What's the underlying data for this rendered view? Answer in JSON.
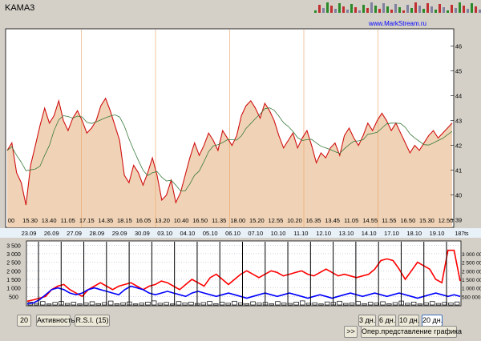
{
  "window": {
    "title": "KAMA3",
    "credit": "www.MarkStream.ru"
  },
  "toolbar": {
    "period_value": "20",
    "activity_label": "Активность",
    "rsi_label": "R.S.I. (15)",
    "scroll_label": ">>",
    "ranges": [
      {
        "label": "3 дн.",
        "active": false
      },
      {
        "label": "6 дн.",
        "active": false
      },
      {
        "label": "10 дн.",
        "active": false
      },
      {
        "label": "20 дн.",
        "active": true
      }
    ],
    "chart_mode_label": "Опер.представление графика"
  },
  "colors": {
    "plot_bg": "#ffffff",
    "price_fill": "#f0d3b6",
    "price_line": "#d01010",
    "sma_line": "#3a7a3a",
    "vertical_markers": "#e8a060",
    "volume_up": "#ff0000",
    "volume_down": "#0000ff",
    "activity_bars": "#000000",
    "day_separator": "#000000",
    "strip_bg": "#e8f0f8"
  },
  "chart_data": [
    {
      "type": "line",
      "series": [
        {
          "values": [
            41.8,
            42.1,
            40.9,
            40.5,
            39.6,
            41.2,
            42.0,
            42.8,
            43.5,
            42.9,
            43.2,
            43.8,
            43.0,
            42.6,
            43.1,
            43.4,
            43.0,
            42.5,
            42.7,
            43.0,
            43.6,
            43.9,
            43.4,
            42.8,
            42.2,
            40.8,
            40.5,
            41.2,
            40.9,
            40.4,
            40.9,
            41.5,
            40.8,
            39.8,
            40.0,
            40.6,
            39.7,
            40.1,
            40.8,
            41.5,
            42.1,
            41.6,
            42.0,
            42.5,
            42.2,
            41.8,
            42.6,
            42.3,
            42.0,
            42.4,
            43.2,
            43.6,
            43.8,
            43.5,
            43.1,
            43.7,
            43.4,
            43.0,
            42.4,
            41.9,
            42.2,
            42.5,
            41.9,
            42.3,
            42.6,
            42.0,
            41.3,
            41.7,
            41.5,
            41.9,
            42.1,
            41.6,
            42.4,
            42.7,
            42.3,
            42.0,
            42.4,
            42.9,
            42.6,
            43.0,
            43.3,
            43.0,
            42.6,
            42.9,
            42.5,
            42.1,
            41.7,
            42.0,
            41.8,
            42.1,
            42.4,
            42.6,
            42.3,
            42.5,
            42.7,
            42.9
          ]
        },
        {
          "values": []
        }
      ],
      "x_tick_labels": [
        "00",
        "15.30",
        "13.40",
        "11.05",
        "17.15",
        "14.35",
        "18.15",
        "16.05",
        "13.20",
        "10.40",
        "16.50",
        "11.35",
        "18.00",
        "15.20",
        "12.55",
        "10.20",
        "16.35",
        "13.45",
        "11.05",
        "14.55",
        "11.55",
        "16.50",
        "15.30",
        "12.50"
      ],
      "y_tick_labels": [
        "39",
        "40",
        "41",
        "42",
        "43",
        "44",
        "45",
        "46"
      ],
      "ylim": [
        38.7,
        46.7
      ]
    },
    {
      "type": "line",
      "series": [
        {
          "values": [
            220,
            300,
            400,
            500,
            900,
            1100,
            1200,
            900,
            700,
            500,
            900,
            1100,
            1300,
            1100,
            900,
            1100,
            1200,
            1300,
            1100,
            900,
            1100,
            1200,
            1400,
            1300,
            1100,
            900,
            1200,
            1500,
            1300,
            1100,
            1600,
            1800,
            1500,
            1200,
            1500,
            1800,
            2000,
            1800,
            1600,
            1800,
            2000,
            1900,
            1700,
            1800,
            1900,
            2000,
            1800,
            1700,
            1900,
            2100,
            1900,
            1700,
            1800,
            1700,
            1600,
            1700,
            1800,
            2100,
            2600,
            2700,
            2600,
            2100,
            1500,
            2000,
            2500,
            2300,
            2100,
            1500,
            1300,
            3200,
            3200,
            1400
          ]
        },
        {
          "values": [
            60,
            120,
            300,
            600,
            900,
            1000,
            900,
            700,
            600,
            700,
            900,
            1000,
            900,
            800,
            700,
            600,
            900,
            1100,
            1000,
            900,
            700,
            600,
            700,
            800,
            700,
            600,
            500,
            700,
            800,
            700,
            600,
            500,
            600,
            700,
            600,
            500,
            400,
            500,
            600,
            700,
            600,
            500,
            600,
            700,
            600,
            500,
            400,
            500,
            600,
            500,
            400,
            500,
            600,
            700,
            600,
            500,
            600,
            700,
            600,
            500,
            600,
            700,
            600,
            500,
            400,
            500,
            600,
            700,
            600,
            500,
            600,
            500
          ]
        }
      ],
      "x_tick_labels": [
        "23.09",
        "26.09",
        "27.09",
        "28.09",
        "29.09",
        "30.09",
        "03.10",
        "04.10",
        "05.10",
        "06.10",
        "07.10",
        "10.10",
        "11.10",
        "12.10",
        "13.10",
        "14.10",
        "17.10",
        "18.10",
        "19.10"
      ],
      "y_left_tick_labels": [
        "3 500",
        "3 000",
        "2 500",
        "2 000",
        "1 500",
        "1 000",
        "500"
      ],
      "y_right_tick_labels": [
        "3 000 000",
        "2 500 000",
        "2 000 000",
        "1 500 000",
        "1 000 000",
        "500 000"
      ],
      "ylim": [
        0,
        3700
      ],
      "corner_label": "187ts",
      "bars": [
        160,
        90,
        200,
        60,
        150,
        210,
        90,
        160,
        60,
        120,
        190,
        80,
        140,
        230,
        70,
        130,
        180,
        60,
        110,
        170,
        240,
        100,
        150,
        60,
        200,
        120,
        170,
        90,
        140,
        210,
        70,
        160,
        100,
        220,
        130,
        80,
        190,
        110,
        150,
        70,
        200,
        120,
        90,
        170,
        240,
        100,
        130,
        60,
        180,
        150,
        220,
        90,
        120,
        200,
        80,
        160,
        110,
        190,
        70,
        140,
        230,
        100,
        170,
        60,
        130,
        200,
        90,
        150,
        120,
        180
      ]
    }
  ]
}
